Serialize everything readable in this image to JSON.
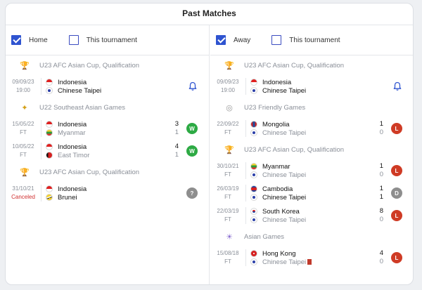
{
  "title": "Past Matches",
  "left": {
    "filters": [
      {
        "label": "Home",
        "checked": true
      },
      {
        "label": "This tournament",
        "checked": false
      }
    ],
    "groups": [
      {
        "competition": "U23 AFC Asian Cup, Qualification",
        "logo": "afc-asian-cup-logo",
        "matches": [
          {
            "date": "09/09/23",
            "status": "19:00",
            "home": {
              "name": "Indonesia",
              "flag": "ind"
            },
            "away": {
              "name": "Chinese Taipei",
              "flag": "tpe"
            },
            "home_score": "",
            "away_score": "",
            "result": "bell"
          }
        ]
      },
      {
        "competition": "U22 Southeast Asian Games",
        "logo": "sea-games-logo",
        "matches": [
          {
            "date": "15/05/22",
            "status": "FT",
            "home": {
              "name": "Indonesia",
              "flag": "ind"
            },
            "away": {
              "name": "Myanmar",
              "flag": "mya"
            },
            "home_score": "3",
            "away_score": "1",
            "result": "W"
          },
          {
            "date": "10/05/22",
            "status": "FT",
            "home": {
              "name": "Indonesia",
              "flag": "ind"
            },
            "away": {
              "name": "East Timor",
              "flag": "tls"
            },
            "home_score": "4",
            "away_score": "1",
            "result": "W"
          }
        ]
      },
      {
        "competition": "U23 AFC Asian Cup, Qualification",
        "logo": "afc-asian-cup-logo",
        "matches": [
          {
            "date": "31/10/21",
            "status": "Canceled",
            "home": {
              "name": "Indonesia",
              "flag": "ind"
            },
            "away": {
              "name": "Brunei",
              "flag": "bru"
            },
            "home_score": "",
            "away_score": "",
            "result": "?"
          }
        ]
      }
    ]
  },
  "right": {
    "filters": [
      {
        "label": "Away",
        "checked": true
      },
      {
        "label": "This tournament",
        "checked": false
      }
    ],
    "groups": [
      {
        "competition": "U23 AFC Asian Cup, Qualification",
        "logo": "afc-asian-cup-logo",
        "matches": [
          {
            "date": "09/09/23",
            "status": "19:00",
            "home": {
              "name": "Indonesia",
              "flag": "ind"
            },
            "away": {
              "name": "Chinese Taipei",
              "flag": "tpe"
            },
            "home_score": "",
            "away_score": "",
            "result": "bell"
          }
        ]
      },
      {
        "competition": "U23 Friendly Games",
        "logo": "friendly-games-logo",
        "matches": [
          {
            "date": "22/09/22",
            "status": "FT",
            "home": {
              "name": "Mongolia",
              "flag": "mng"
            },
            "away": {
              "name": "Chinese Taipei",
              "flag": "tpe"
            },
            "home_score": "1",
            "away_score": "0",
            "result": "L"
          }
        ]
      },
      {
        "competition": "U23 AFC Asian Cup, Qualification",
        "logo": "afc-asian-cup-logo",
        "matches": [
          {
            "date": "30/10/21",
            "status": "FT",
            "home": {
              "name": "Myanmar",
              "flag": "mya"
            },
            "away": {
              "name": "Chinese Taipei",
              "flag": "tpe"
            },
            "home_score": "1",
            "away_score": "0",
            "result": "L"
          },
          {
            "date": "26/03/19",
            "status": "FT",
            "home": {
              "name": "Cambodia",
              "flag": "cam"
            },
            "away": {
              "name": "Chinese Taipei",
              "flag": "tpe"
            },
            "home_score": "1",
            "away_score": "1",
            "result": "D"
          },
          {
            "date": "22/03/19",
            "status": "FT",
            "home": {
              "name": "South Korea",
              "flag": "kor"
            },
            "away": {
              "name": "Chinese Taipei",
              "flag": "tpe"
            },
            "home_score": "8",
            "away_score": "0",
            "result": "L"
          }
        ]
      },
      {
        "competition": "Asian Games",
        "logo": "asian-games-logo",
        "matches": [
          {
            "date": "15/08/18",
            "status": "FT",
            "home": {
              "name": "Hong Kong",
              "flag": "hkg"
            },
            "away": {
              "name": "Chinese Taipei",
              "flag": "tpe",
              "red_card": true
            },
            "home_score": "4",
            "away_score": "0",
            "result": "L"
          }
        ]
      }
    ]
  },
  "colors": {
    "accent": "#2f54d0",
    "win": "#2daa44",
    "loss": "#cf3b25",
    "draw": "#8e8e8e",
    "canceled": "#d03030"
  }
}
